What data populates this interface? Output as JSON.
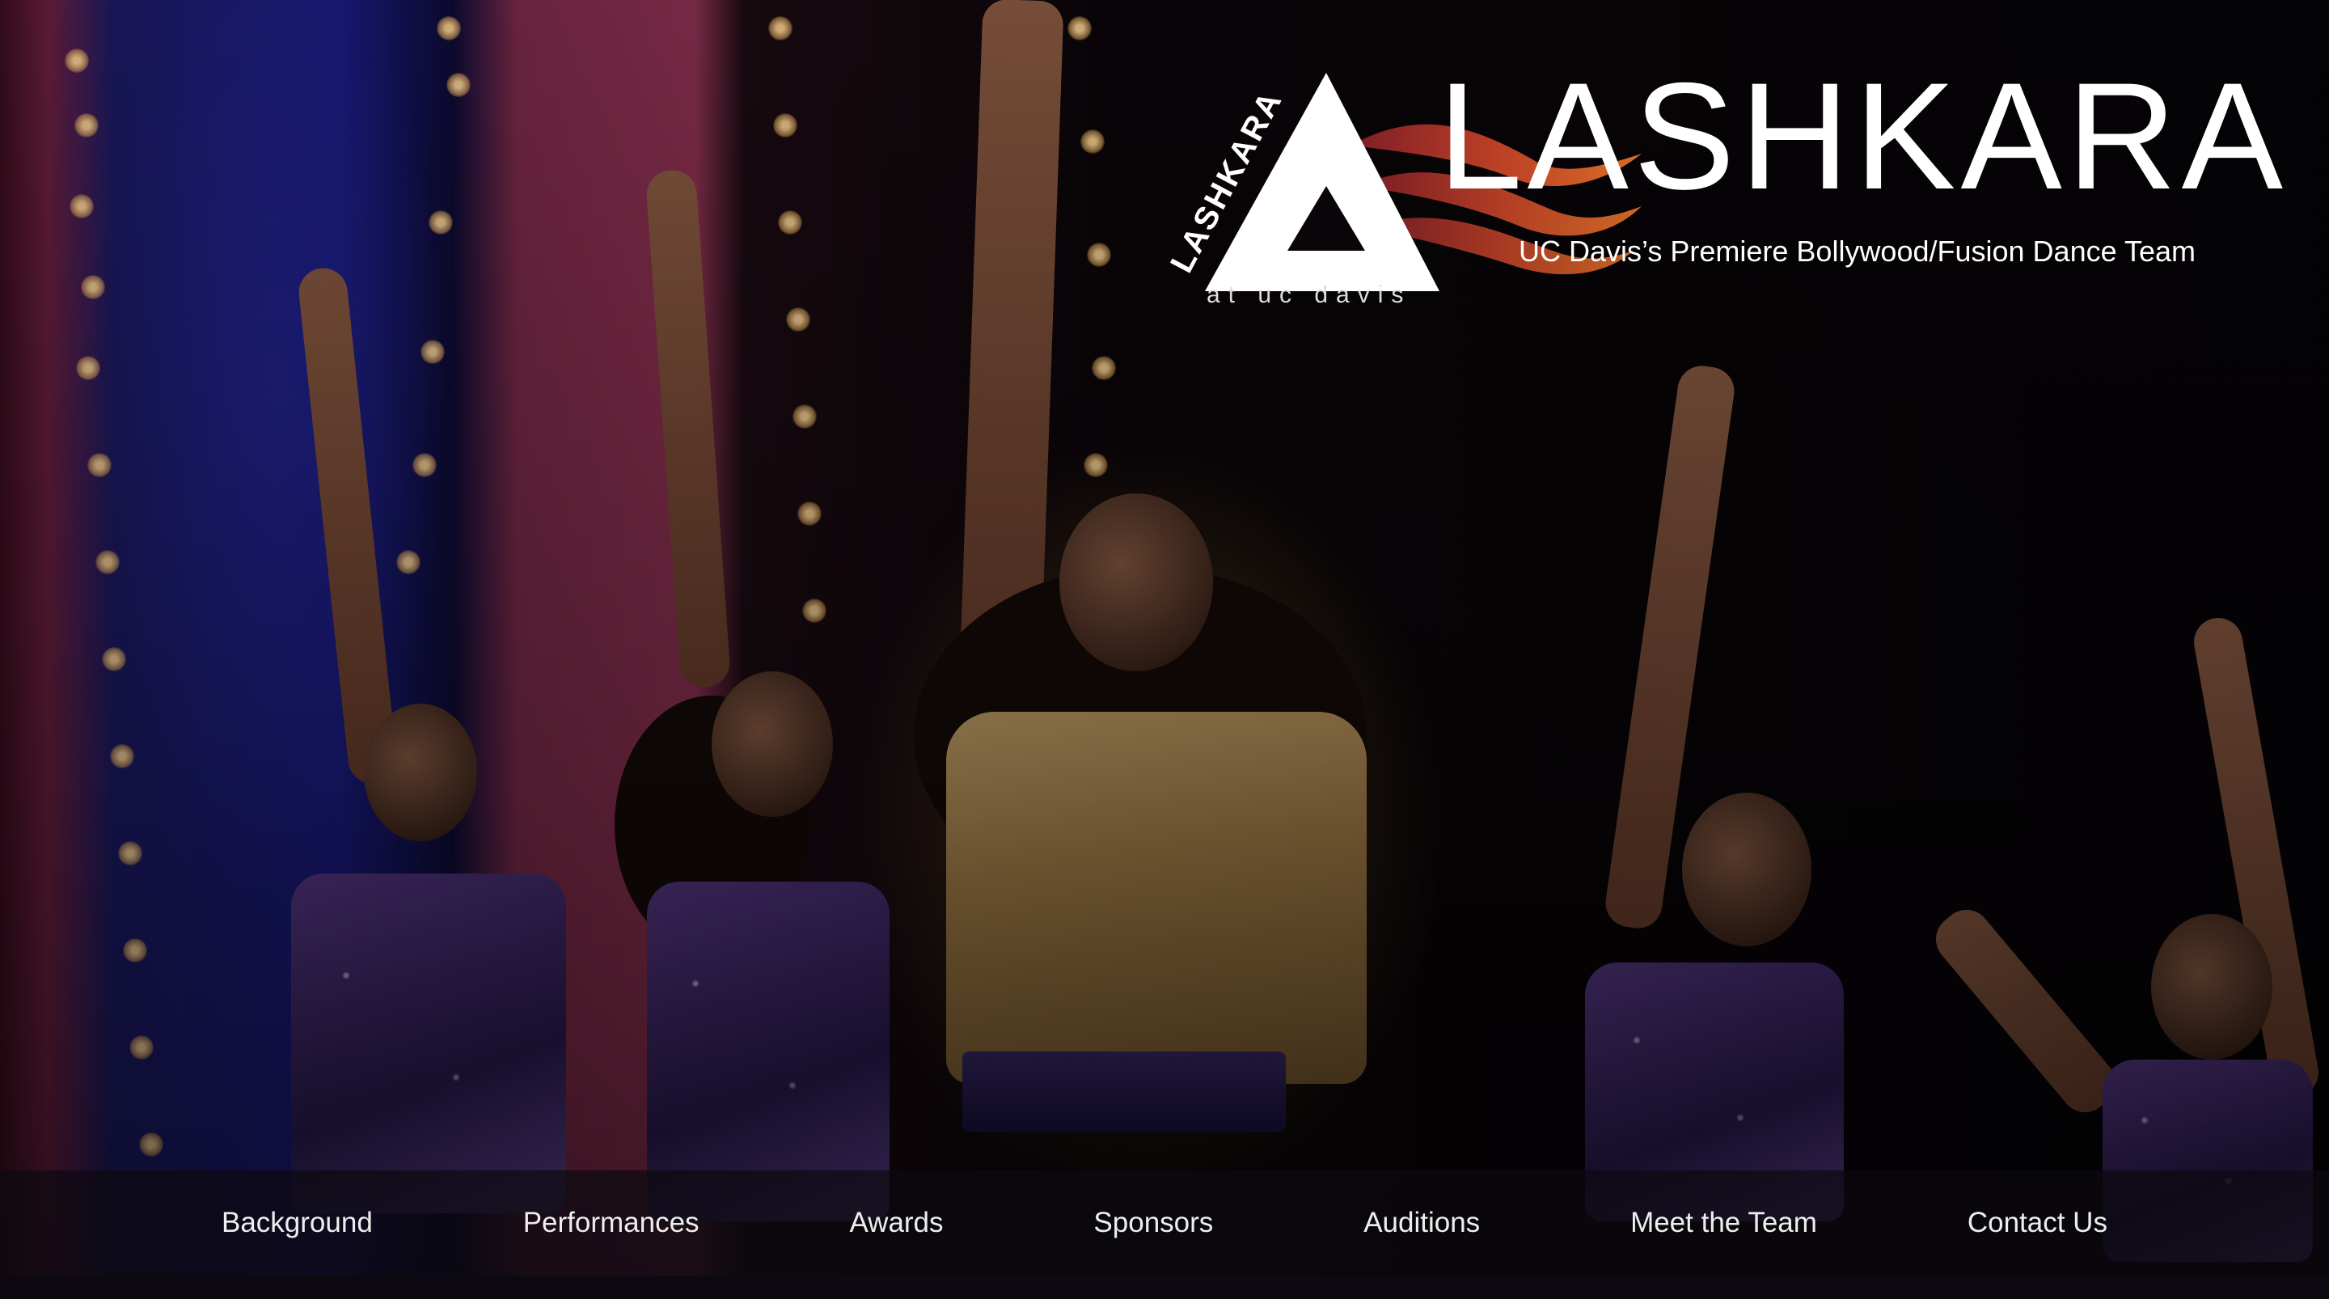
{
  "brand": {
    "wordmark": "LASHKARA",
    "tagline": "UC Davis’s Premiere Bollywood/Fusion Dance Team",
    "mark_text": "LASHKARA",
    "mark_subtext": "at uc davis",
    "colors": {
      "flame_orange": "#e8602a",
      "flame_red": "#b83a2a",
      "white": "#ffffff"
    }
  },
  "nav": {
    "items": [
      {
        "label": "Background"
      },
      {
        "label": "Performances"
      },
      {
        "label": "Awards"
      },
      {
        "label": "Sponsors"
      },
      {
        "label": "Auditions"
      },
      {
        "label": "Meet the Team"
      },
      {
        "label": "Contact Us"
      }
    ]
  }
}
